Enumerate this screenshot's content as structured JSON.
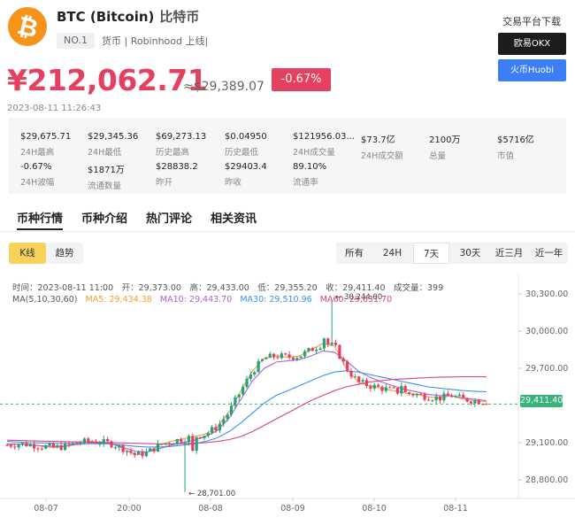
{
  "coin": {
    "logo_icon": "bitcoin-icon",
    "logo_symbol": "₿",
    "title": "BTC (Bitcoin)",
    "title_cn": "比特币",
    "rank": "NO.1",
    "tags": "货币 | Robinhood 上线|"
  },
  "price": {
    "cny": "¥212,062.71",
    "usd": "≈$29,389.07",
    "change": "-0.67%",
    "timestamp": "2023-08-11 11:26:43"
  },
  "exchanges": {
    "title": "交易平台下载",
    "okx_label": "欧易OKX",
    "huobi_label": "火币Huobi"
  },
  "stats": [
    {
      "value": "$29,675.71",
      "label": "24H最高"
    },
    {
      "value": "$29,345.36",
      "label": "24H最低"
    },
    {
      "value": "$69,273.13",
      "label": "历史最高"
    },
    {
      "value": "$0.04950",
      "label": "历史最低"
    },
    {
      "value": "$121956.03...",
      "label": "24H成交量"
    },
    {
      "value": "$73.7亿",
      "label": "24H成交额"
    },
    {
      "value": "2100万",
      "label": "总量"
    },
    {
      "value": "$5716亿",
      "label": "市值"
    },
    {
      "value": "-0.67%",
      "label": "24H波幅"
    },
    {
      "value": "$1871万",
      "label": "流通数量"
    },
    {
      "value": "$28838.2",
      "label": "昨开"
    },
    {
      "value": "$29403.4",
      "label": "昨收"
    },
    {
      "value": "89.10%",
      "label": "流通率"
    }
  ],
  "tabs": [
    "币种行情",
    "币种介绍",
    "热门评论",
    "相关资讯"
  ],
  "chart_mode": {
    "kline": "K线",
    "trend": "趋势"
  },
  "ranges": [
    "所有",
    "24H",
    "7天",
    "30天",
    "近三月",
    "近一年"
  ],
  "selected_range": "7天",
  "ohlc_info": "时间：2023-08-11 11:00　开：29,373.00　高：29,433.00　低：29,355.20　收：29,411.40　成交量：399",
  "ma_info": {
    "prefix": "MA(5,10,30,60)",
    "ma5": "MA5: 29,434.38",
    "ma10": "MA10: 29,443.70",
    "ma30": "MA30: 29,510.96",
    "ma60": "MA60: 29,631.70"
  },
  "colors": {
    "up": "#e64060",
    "down": "#26a17b",
    "ma5": "#f0a030",
    "ma10": "#b060d0",
    "ma30": "#3c90f0",
    "ma60": "#e0407a",
    "last_price": "#34b37a"
  },
  "chart_data": {
    "type": "candlestick",
    "x_ticks": [
      "08-07",
      "20:00",
      "08-08",
      "08-09",
      "08-10",
      "08-11"
    ],
    "y_ticks": [
      "30,300.00",
      "30,000.00",
      "29,700.00",
      "29,100.00",
      "28,800.00"
    ],
    "ylim": [
      28650,
      30400
    ],
    "last_price": "29,411.40",
    "high_marker": "30,244.00",
    "low_marker": "28,701.00",
    "series": [
      {
        "name": "MA5",
        "values": [
          29080,
          29090,
          29085,
          29070,
          29060,
          29070,
          29100,
          29110,
          29105,
          29090,
          29050,
          29000,
          29020,
          29080,
          29110,
          29130,
          29150,
          29170,
          29230,
          29350,
          29520,
          29680,
          29780,
          29800,
          29790,
          29800,
          29850,
          29900,
          29880,
          29700,
          29590,
          29560,
          29540,
          29520,
          29500,
          29490,
          29470,
          29460,
          29480,
          29450,
          29440,
          29430
        ]
      },
      {
        "name": "MA10",
        "values": [
          29090,
          29088,
          29082,
          29075,
          29070,
          29072,
          29085,
          29095,
          29098,
          29090,
          29060,
          29030,
          29025,
          29050,
          29080,
          29100,
          29120,
          29150,
          29200,
          29300,
          29450,
          29600,
          29700,
          29750,
          29760,
          29770,
          29800,
          29840,
          29830,
          29760,
          29680,
          29630,
          29590,
          29560,
          29530,
          29510,
          29490,
          29480,
          29480,
          29460,
          29450,
          29440
        ]
      },
      {
        "name": "MA30",
        "values": [
          29110,
          29105,
          29100,
          29098,
          29095,
          29093,
          29092,
          29092,
          29092,
          29090,
          29080,
          29070,
          29065,
          29065,
          29070,
          29080,
          29090,
          29110,
          29140,
          29190,
          29260,
          29340,
          29420,
          29480,
          29520,
          29560,
          29600,
          29640,
          29670,
          29680,
          29670,
          29650,
          29630,
          29610,
          29590,
          29570,
          29550,
          29540,
          29530,
          29520,
          29515,
          29510
        ]
      },
      {
        "name": "MA60",
        "values": [
          29120,
          29118,
          29115,
          29112,
          29110,
          29108,
          29106,
          29104,
          29102,
          29100,
          29098,
          29095,
          29092,
          29090,
          29090,
          29092,
          29095,
          29100,
          29110,
          29125,
          29150,
          29190,
          29240,
          29290,
          29340,
          29390,
          29440,
          29480,
          29520,
          29550,
          29570,
          29590,
          29600,
          29610,
          29615,
          29620,
          29625,
          29628,
          29630,
          29632,
          29632,
          29631
        ]
      }
    ]
  }
}
